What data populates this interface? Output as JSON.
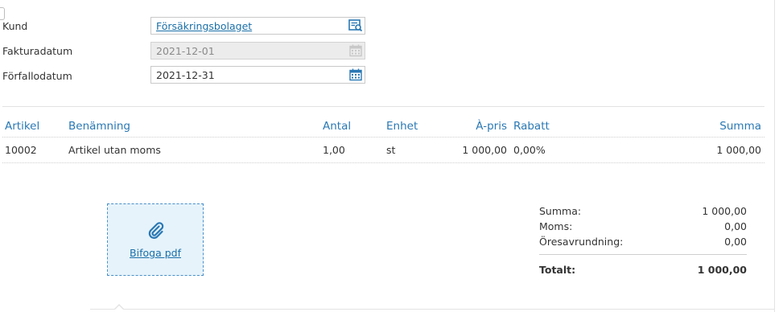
{
  "form": {
    "customer": {
      "label": "Kund",
      "value": "Försäkringsbolaget"
    },
    "invoice_date": {
      "label": "Fakturadatum",
      "value": "2021-12-01"
    },
    "due_date": {
      "label": "Förfallodatum",
      "value": "2021-12-31"
    }
  },
  "table": {
    "headers": {
      "article": "Artikel",
      "description": "Benämning",
      "quantity": "Antal",
      "unit": "Enhet",
      "unit_price": "À-pris",
      "discount": "Rabatt",
      "sum": "Summa"
    },
    "rows": [
      {
        "article": "10002",
        "description": "Artikel utan moms",
        "quantity": "1,00",
        "unit": "st",
        "unit_price": "1 000,00",
        "discount": "0,00%",
        "sum": "1 000,00"
      }
    ]
  },
  "attachment": {
    "label": "Bifoga pdf",
    "icon": "paperclip-icon"
  },
  "totals": {
    "subtotal": {
      "label": "Summa:",
      "value": "1 000,00"
    },
    "vat": {
      "label": "Moms:",
      "value": "0,00"
    },
    "rounding": {
      "label": "Öresavrundning:",
      "value": "0,00"
    },
    "total": {
      "label": "Totalt:",
      "value": "1 000,00"
    }
  },
  "colors": {
    "accent": "#2a78b4",
    "link": "#1a6fa8",
    "attach_bg": "#e6f3fb"
  }
}
